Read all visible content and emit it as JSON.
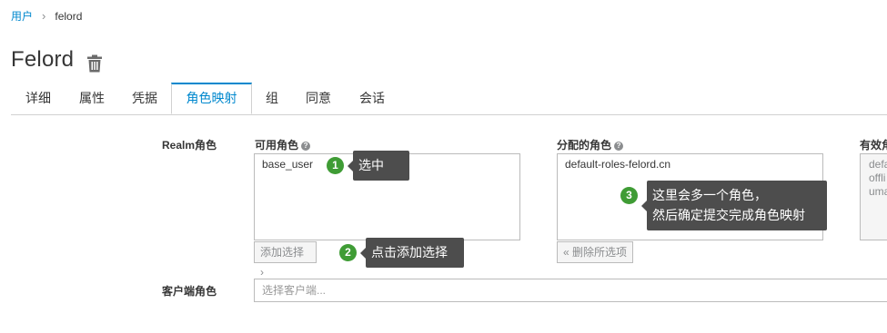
{
  "breadcrumb": {
    "parent": "用户",
    "current": "felord"
  },
  "title": "Felord",
  "tabs": [
    "详细",
    "属性",
    "凭据",
    "角色映射",
    "组",
    "同意",
    "会话"
  ],
  "active_tab": "角色映射",
  "realm_roles": {
    "label": "Realm角色",
    "available": {
      "label": "可用角色",
      "items": [
        "base_user"
      ],
      "button": "添加选择 ›"
    },
    "assigned": {
      "label": "分配的角色",
      "items": [
        "default-roles-felord.cn"
      ],
      "button": "« 删除所选项"
    },
    "effective": {
      "label": "有效角",
      "items": [
        "defa",
        "offli",
        "uma"
      ]
    }
  },
  "client_roles": {
    "label": "客户端角色",
    "placeholder": "选择客户端..."
  },
  "callouts": [
    {
      "num": "1",
      "text": "选中"
    },
    {
      "num": "2",
      "text": "点击添加选择"
    },
    {
      "num": "3",
      "line1": "这里会多一个角色，",
      "line2": "然后确定提交完成角色映射"
    }
  ]
}
